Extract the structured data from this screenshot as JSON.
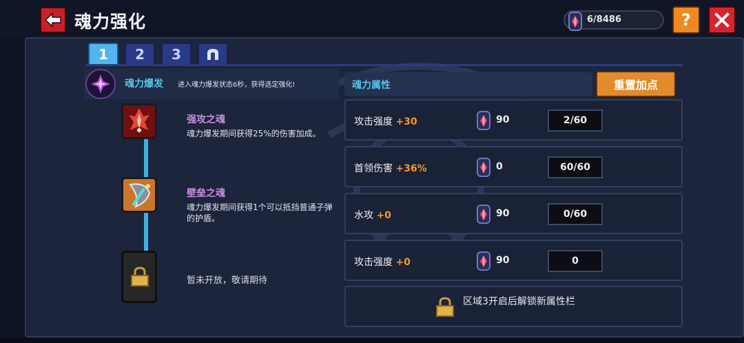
{
  "header": {
    "title": "魂力强化",
    "currency_value": "6/8486",
    "help_label": "?"
  },
  "tabs": [
    {
      "label": "1",
      "active": true
    },
    {
      "label": "2",
      "active": false
    },
    {
      "label": "3",
      "active": false
    },
    {
      "label": "",
      "icon": "arch-icon",
      "active": false
    }
  ],
  "burst": {
    "name": "魂力爆发",
    "description": "进入魂力爆发状态6秒，获得选定强化!"
  },
  "skills": [
    {
      "title": "强攻之魂",
      "description": "魂力爆发期间获得25%的伤害加成。"
    },
    {
      "title": "壁垒之魂",
      "description": "魂力爆发期间获得1个可以抵挡普通子弹的护盾。"
    }
  ],
  "locked_skill_text": "暂未开放，敬请期待",
  "attributes": {
    "header_label": "魂力属性",
    "reset_label": "重置加点",
    "rows": [
      {
        "name": "攻击强度",
        "bonus": "+30",
        "cost": "90",
        "level": "2/60"
      },
      {
        "name": "首领伤害",
        "bonus": "+36%",
        "cost": "0",
        "level": "60/60"
      },
      {
        "name": "水攻",
        "bonus": "+0",
        "cost": "90",
        "level": "0/60"
      },
      {
        "name": "攻击强度",
        "bonus": "+0",
        "cost": "90",
        "level": "0"
      }
    ],
    "unlock_text": "区域3开启后解锁新属性栏"
  },
  "colors": {
    "accent_blue": "#56c4e6",
    "bonus_orange": "#f39a2b",
    "skill_purple": "#c98ce2",
    "button_orange": "#e28a2c",
    "close_red": "#d6232c"
  }
}
